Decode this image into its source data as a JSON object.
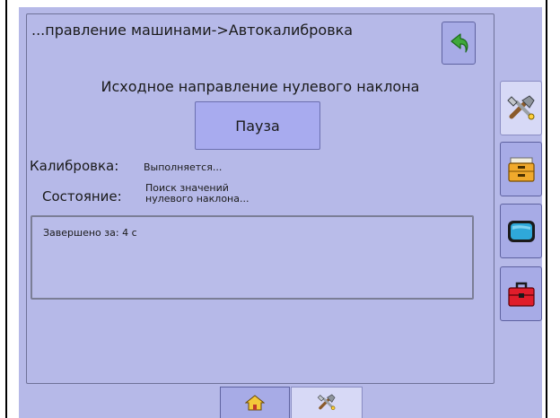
{
  "header": {
    "title": "...правление машинами->Автокалибровка",
    "back_icon": "back-arrow-icon"
  },
  "main": {
    "heading": "Исходное направление нулевого наклона",
    "pause_label": "Пауза",
    "calibration_label": "Калибровка:",
    "calibration_value": "Выполняется...",
    "state_label": "Состояние:",
    "state_value_line1": "Поиск значений",
    "state_value_line2": "нулевого наклона...",
    "log_text": "Завершено за: 4 с"
  },
  "sidebar": {
    "items": [
      {
        "icon": "tools-icon",
        "active": true
      },
      {
        "icon": "file-drawer-icon",
        "active": false
      },
      {
        "icon": "display-icon",
        "active": false
      },
      {
        "icon": "toolbox-icon",
        "active": false
      }
    ]
  },
  "bottom_tabs": [
    {
      "icon": "home-icon",
      "active": false
    },
    {
      "icon": "tools-icon",
      "active": true
    }
  ],
  "colors": {
    "screen_bg": "#b6b9e8",
    "button_bg": "#a7abe6",
    "active_bg": "#d7d9f6",
    "text": "#1a1a1a"
  }
}
